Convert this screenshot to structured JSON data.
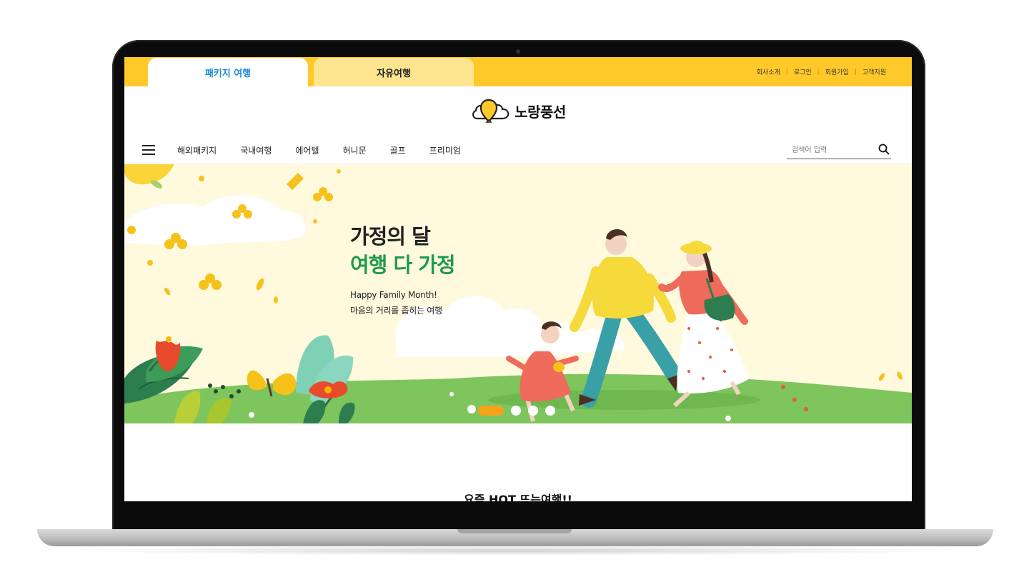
{
  "top_tabs": [
    {
      "label": "패키지 여행",
      "active": true
    },
    {
      "label": "자유여행",
      "active": false
    }
  ],
  "util_links": [
    "회사소개",
    "로그인",
    "회원가입",
    "고객지원"
  ],
  "logo": {
    "text": "노랑풍선",
    "icon": "yellow-balloon-cloud-icon"
  },
  "nav": {
    "menu_icon": "hamburger-icon",
    "items": [
      "해외패키지",
      "국내여행",
      "에어텔",
      "허니문",
      "골프",
      "프리미엄"
    ]
  },
  "search": {
    "placeholder": "검색어 입력",
    "value": "",
    "icon": "search-icon"
  },
  "hero": {
    "title_line1": "가정의 달",
    "title_line2": "여행 다 가정",
    "subtitle_line1": "Happy Family Month!",
    "subtitle_line2": "마음의 거리를 좁히는 여행",
    "slide_count": 4,
    "active_slide": 1
  },
  "section": {
    "title": "요즘 HOT 뜨는여행!!"
  },
  "colors": {
    "brand_yellow": "#ffc929",
    "tab_inactive": "#ffe58f",
    "active_tab_text": "#1b8ad8",
    "hero_green_text": "#1e9a4e",
    "hero_bg": "#fff9de",
    "slider_active": "#f7a21b"
  }
}
